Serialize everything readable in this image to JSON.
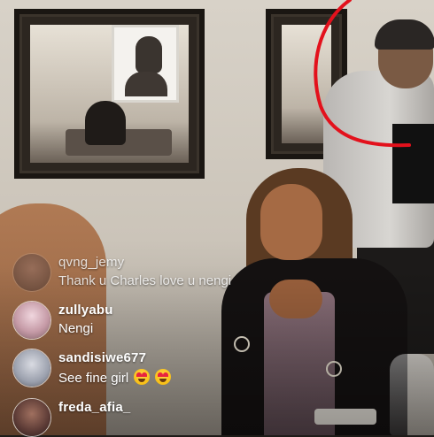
{
  "colors": {
    "annotation_stroke": "#e3111c",
    "comment_text": "#ffffff"
  },
  "comments": [
    {
      "username": "qvng_jemy",
      "message": "Thank u Charles love u nengi",
      "avatar": "avatar-dark"
    },
    {
      "username": "zullyabu",
      "message": "Nengi",
      "avatar": "avatar-pink"
    },
    {
      "username": "sandisiwe677",
      "message": "See fine girl",
      "emojis": [
        "heart-eyes-emoji",
        "heart-eyes-emoji"
      ],
      "avatar": "avatar-grey"
    },
    {
      "username": "freda_afia_",
      "message": "",
      "avatar": "avatar-brown"
    }
  ]
}
